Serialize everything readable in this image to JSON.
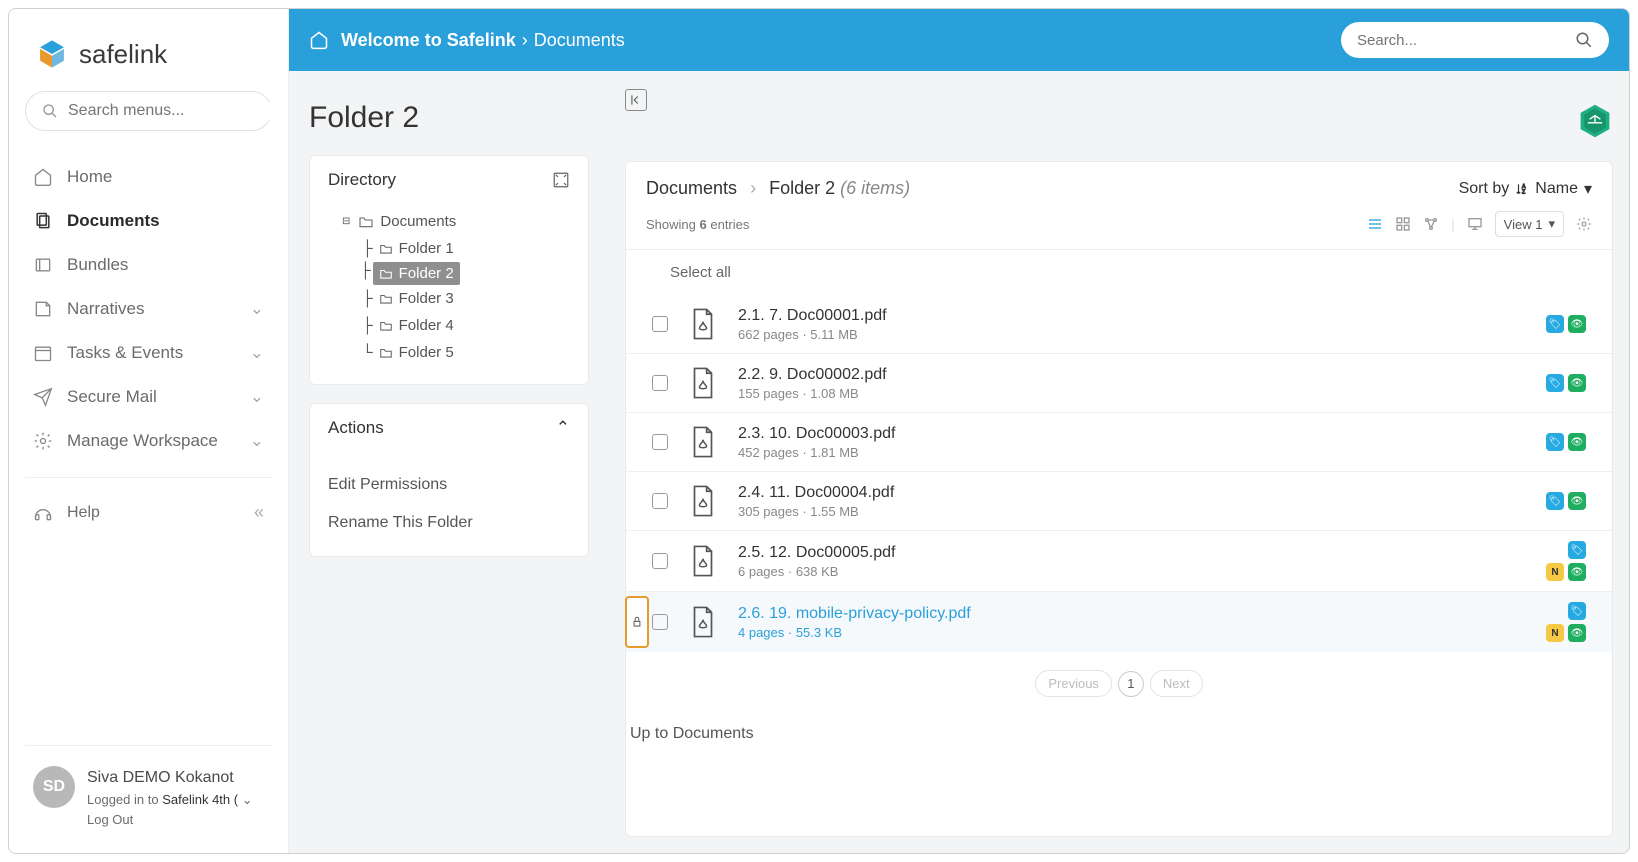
{
  "brand": {
    "name": "safelink"
  },
  "sidebar": {
    "search_placeholder": "Search menus...",
    "items": [
      {
        "icon": "home",
        "label": "Home"
      },
      {
        "icon": "docs",
        "label": "Documents",
        "active": true
      },
      {
        "icon": "bundles",
        "label": "Bundles"
      },
      {
        "icon": "narratives",
        "label": "Narratives",
        "chev": true
      },
      {
        "icon": "tasks",
        "label": "Tasks & Events",
        "chev": true
      },
      {
        "icon": "mail",
        "label": "Secure Mail",
        "chev": true
      },
      {
        "icon": "gear",
        "label": "Manage Workspace",
        "chev": true
      }
    ],
    "help_label": "Help"
  },
  "user": {
    "initials": "SD",
    "name": "Siva DEMO Kokanot",
    "logged_in_prefix": "Logged in to",
    "workspace": "Safelink 4th (",
    "logout": "Log Out"
  },
  "topbar": {
    "welcome": "Welcome to Safelink",
    "current": "Documents",
    "search_placeholder": "Search..."
  },
  "leftpanel": {
    "title": "Folder 2",
    "directory_label": "Directory",
    "tree_root": "Documents",
    "tree_children": [
      "Folder 1",
      "Folder 2",
      "Folder 3",
      "Folder 4",
      "Folder 5"
    ],
    "tree_selected": "Folder 2",
    "actions_label": "Actions",
    "actions": [
      "Edit Permissions",
      "Rename This Folder"
    ]
  },
  "content": {
    "path_root": "Documents",
    "path_folder": "Folder 2",
    "item_count_label": "(6 items)",
    "sort_label": "Sort by",
    "sort_value": "Name",
    "showing_prefix": "Showing",
    "showing_count": "6",
    "showing_suffix": "entries",
    "view_label": "View 1",
    "select_all": "Select all",
    "files": [
      {
        "name": "2.1. 7. Doc00001.pdf",
        "meta": "662 pages · 5.11 MB",
        "tags": [
          "blue",
          "green"
        ]
      },
      {
        "name": "2.2. 9. Doc00002.pdf",
        "meta": "155 pages · 1.08 MB",
        "tags": [
          "blue",
          "green"
        ]
      },
      {
        "name": "2.3. 10. Doc00003.pdf",
        "meta": "452 pages · 1.81 MB",
        "tags": [
          "blue",
          "green"
        ]
      },
      {
        "name": "2.4. 11. Doc00004.pdf",
        "meta": "305 pages · 1.55 MB",
        "tags": [
          "blue",
          "green"
        ]
      },
      {
        "name": "2.5. 12. Doc00005.pdf",
        "meta": "6 pages · 638 KB",
        "tags": [
          "blue"
        ],
        "extra": [
          "N",
          "green"
        ]
      },
      {
        "name": "2.6. 19. mobile-privacy-policy.pdf",
        "meta": "4 pages · 55.3 KB",
        "tags": [
          "blue"
        ],
        "extra": [
          "N",
          "green"
        ],
        "active": true,
        "drag": true
      }
    ],
    "prev": "Previous",
    "page": "1",
    "next": "Next",
    "up_link": "Up to Documents"
  }
}
